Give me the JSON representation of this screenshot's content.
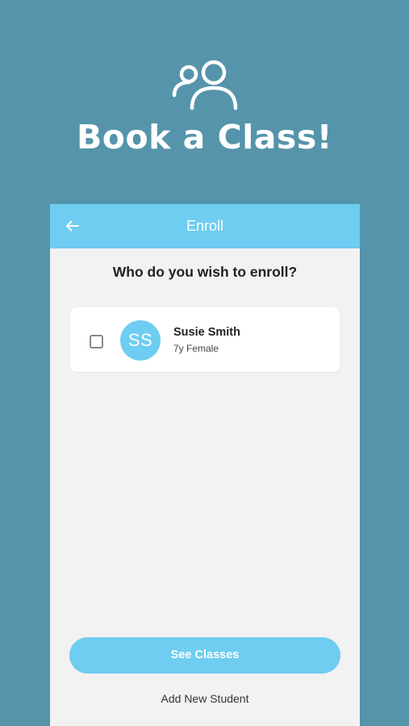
{
  "hero": {
    "icon": "users-icon",
    "title": "Book a Class!"
  },
  "appbar": {
    "back_icon": "arrow-left-icon",
    "title": "Enroll"
  },
  "prompt": "Who do you wish to enroll?",
  "students": [
    {
      "initials": "SS",
      "name": "Susie Smith",
      "meta": "7y Female",
      "checked": false
    }
  ],
  "actions": {
    "see_classes": "See Classes",
    "add_new_student": "Add New Student"
  },
  "colors": {
    "background": "#5694ab",
    "accent": "#6ecdf1",
    "surface": "#f2f2f2",
    "card": "#ffffff"
  }
}
